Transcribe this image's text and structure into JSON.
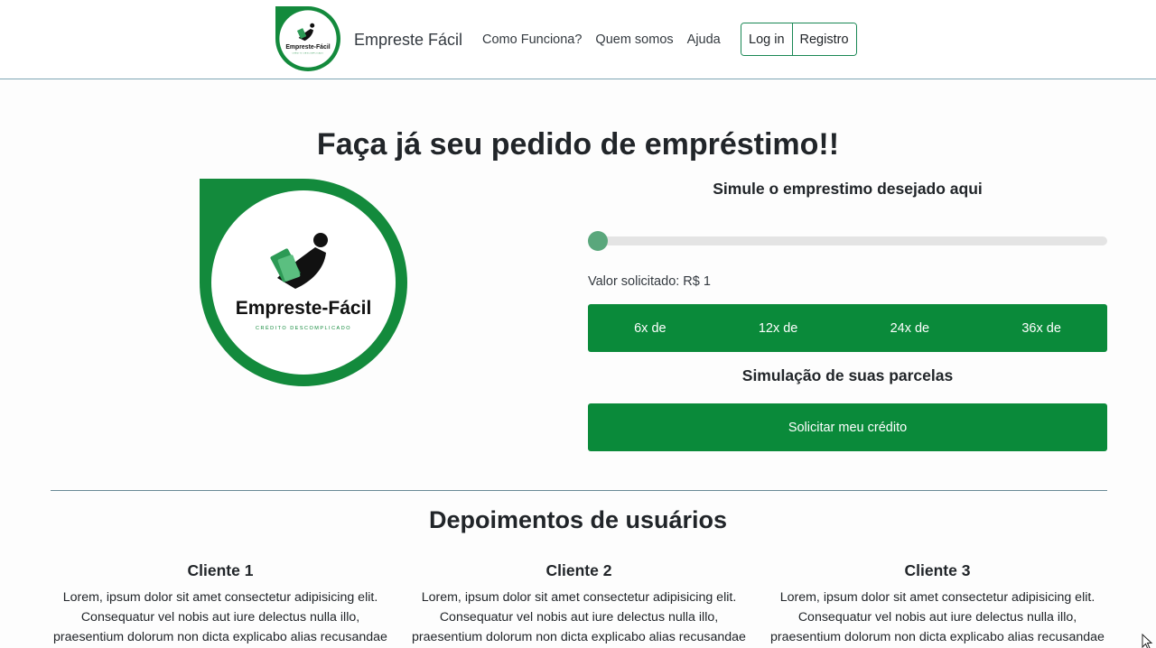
{
  "brand": {
    "name": "Empreste Fácil",
    "logo_text": "Empreste-Fácil",
    "logo_tagline": "CRÉDITO DESCOMPLICADO"
  },
  "nav": {
    "links": [
      "Como Funciona?",
      "Quem somos",
      "Ajuda"
    ],
    "login": "Log in",
    "register": "Registro"
  },
  "hero": {
    "title": "Faça já seu pedido de empréstimo!!"
  },
  "simulator": {
    "title": "Simule o emprestimo desejado aqui",
    "slider_value": 1,
    "value_label": "Valor solicitado: R$ 1",
    "installments": [
      "6x de",
      "12x de",
      "24x de",
      "36x de"
    ],
    "parcelas_title": "Simulação de suas parcelas",
    "cta": "Solicitar meu crédito"
  },
  "testimonials": {
    "title": "Depoimentos de usuários",
    "clients": [
      {
        "name": "Cliente 1",
        "lines": [
          "Lorem, ipsum dolor sit amet consectetur adipisicing elit.",
          "Consequatur vel nobis aut iure delectus nulla illo,",
          "praesentium dolorum non dicta explicabo alias recusandae"
        ]
      },
      {
        "name": "Cliente 2",
        "lines": [
          "Lorem, ipsum dolor sit amet consectetur adipisicing elit.",
          "Consequatur vel nobis aut iure delectus nulla illo,",
          "praesentium dolorum non dicta explicabo alias recusandae"
        ]
      },
      {
        "name": "Cliente 3",
        "lines": [
          "Lorem, ipsum dolor sit amet consectetur adipisicing elit.",
          "Consequatur vel nobis aut iure delectus nulla illo,",
          "praesentium dolorum non dicta explicabo alias recusandae"
        ]
      }
    ]
  },
  "colors": {
    "primary_green": "#0a8a3a",
    "slider_thumb": "#5aa77c",
    "logo_green": "#138a3c"
  },
  "icons": {
    "logo": "empreste-facil-logo",
    "cursor": "mouse-cursor-icon"
  }
}
